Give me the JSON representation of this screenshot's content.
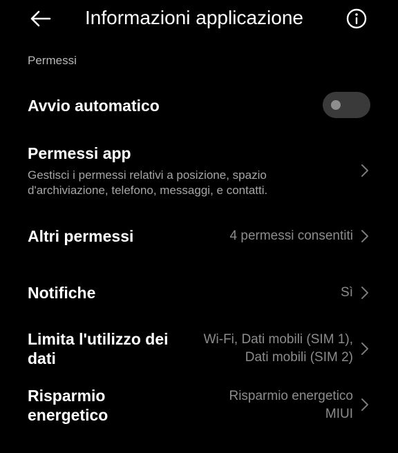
{
  "header": {
    "title": "Informazioni applicazione",
    "back_icon": "arrow-left-icon",
    "info_icon": "info-circle-icon"
  },
  "section": {
    "label": "Permessi"
  },
  "rows": {
    "autostart": {
      "title": "Avvio automatico",
      "toggle_on": false
    },
    "app_permissions": {
      "title": "Permessi app",
      "description": "Gestisci i permessi relativi a posizione, spazio d'archiviazione, telefono, messaggi, e contatti."
    },
    "other_permissions": {
      "title": "Altri permessi",
      "value": "4 permessi consentiti"
    },
    "notifications": {
      "title": "Notifiche",
      "value": "Sì"
    },
    "data_usage": {
      "title": "Limita l'utilizzo dei dati",
      "value": "Wi-Fi, Dati mobili (SIM 1), Dati mobili (SIM 2)"
    },
    "battery_saver": {
      "title": "Risparmio energetico",
      "value": "Risparmio energetico MIUI"
    }
  },
  "colors": {
    "background": "#000000",
    "primary_text": "#ffffff",
    "secondary_text": "#8c8c8c",
    "toggle_track_off": "#3a3a3a"
  }
}
